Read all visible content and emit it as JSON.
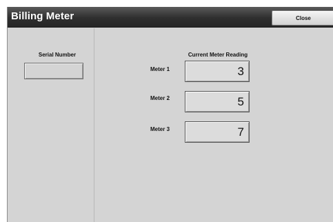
{
  "window": {
    "title": "Billing Meter",
    "close_label": "Close"
  },
  "serial": {
    "label": "Serial Number",
    "value": ""
  },
  "meters": {
    "header": "Current Meter Reading",
    "items": [
      {
        "label": "Meter 1",
        "value": "3"
      },
      {
        "label": "Meter 2",
        "value": "5"
      },
      {
        "label": "Meter 3",
        "value": "7"
      }
    ]
  }
}
